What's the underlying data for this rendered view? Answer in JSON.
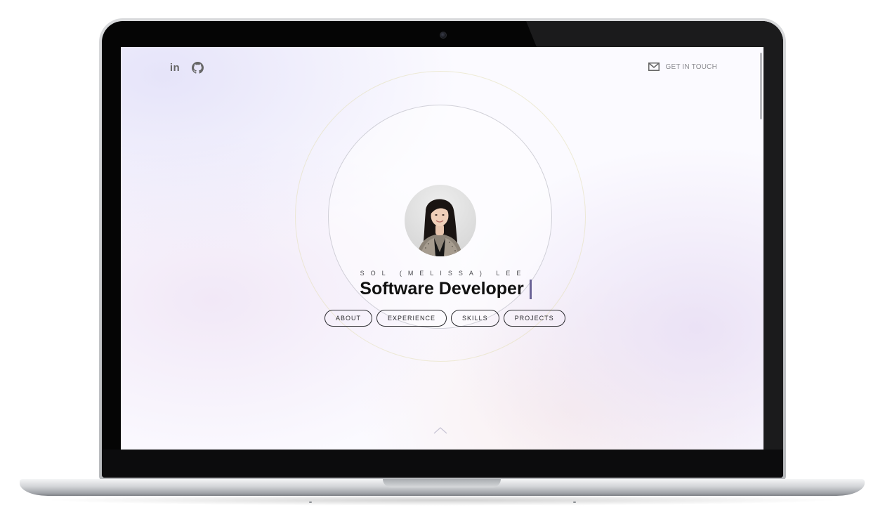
{
  "page": {
    "person_name": "SOL (MELISSA) LEE",
    "role": "Software Developer",
    "contact_label": "GET IN TOUCH",
    "social": {
      "linkedin_label": "in",
      "linkedin_icon": "linkedin-icon",
      "github_icon": "github-icon"
    },
    "nav": [
      {
        "label": "ABOUT"
      },
      {
        "label": "EXPERIENCE"
      },
      {
        "label": "SKILLS"
      },
      {
        "label": "PROJECTS"
      }
    ],
    "icons": {
      "contact": "mail-icon",
      "scroll": "chevron-up-icon"
    }
  },
  "colors": {
    "accent_cursor": "#6a6396",
    "text_primary": "#111111",
    "pill_border": "#2a2a2e"
  }
}
